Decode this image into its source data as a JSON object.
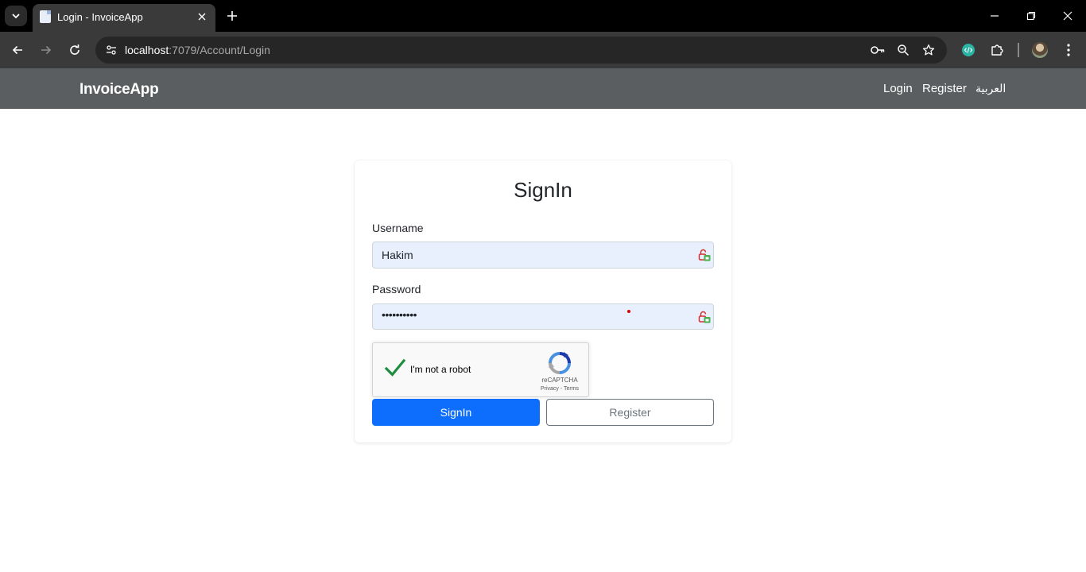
{
  "browser": {
    "tab_title": "Login - InvoiceApp",
    "url_host": "localhost",
    "url_path": ":7079/Account/Login"
  },
  "navbar": {
    "brand": "InvoiceApp",
    "links": [
      "Login",
      "Register",
      "العربية"
    ]
  },
  "form": {
    "title": "SignIn",
    "username_label": "Username",
    "username_value": "Hakim",
    "password_label": "Password",
    "password_value": "••••••••••",
    "recaptcha": {
      "label": "I'm not a robot",
      "brand": "reCAPTCHA",
      "links": "Privacy - Terms"
    },
    "signin_button": "SignIn",
    "register_button": "Register"
  },
  "colors": {
    "navbar_bg": "#5b5e60",
    "primary": "#0d6efd",
    "input_autofill_bg": "#e8f0fe",
    "check_green": "#1e8e3e"
  },
  "icons": [
    "tab-search-icon",
    "page-favicon-icon",
    "close-icon",
    "plus-icon",
    "minimize-icon",
    "restore-icon",
    "window-close-icon",
    "back-icon",
    "forward-icon",
    "reload-icon",
    "site-info-icon",
    "password-key-icon",
    "zoom-icon",
    "star-icon",
    "extension-devtools-icon",
    "puzzle-icon",
    "menu-icon",
    "lock-badge-icon",
    "checkmark-icon",
    "recaptcha-logo-icon"
  ]
}
